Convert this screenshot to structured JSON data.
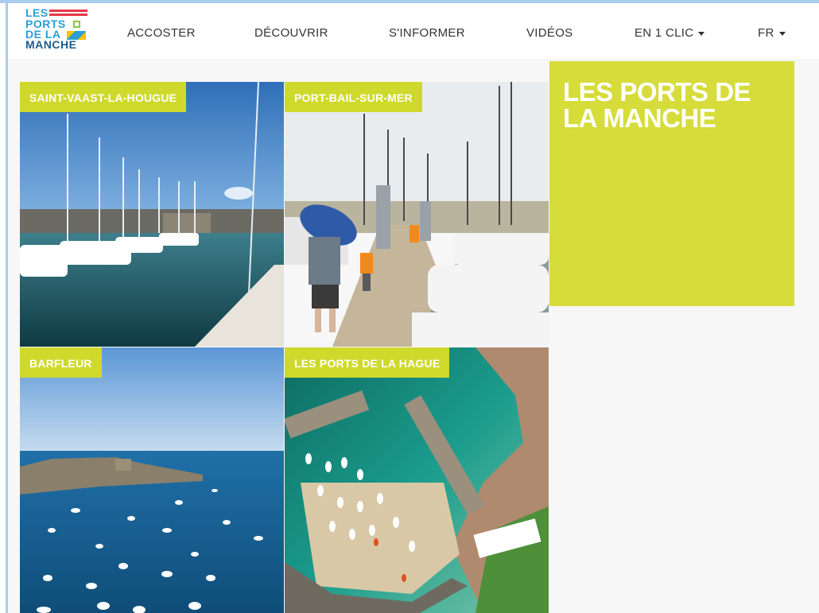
{
  "header": {
    "logo_lines": [
      "LES",
      "PORTS",
      "DE LA",
      "MANCHE"
    ],
    "nav": [
      {
        "label": "ACCOSTER",
        "dropdown": false
      },
      {
        "label": "DÉCOUVRIR",
        "dropdown": false
      },
      {
        "label": "S'INFORMER",
        "dropdown": false
      },
      {
        "label": "VIDÉOS",
        "dropdown": false
      },
      {
        "label": "EN 1 CLIC",
        "dropdown": true
      },
      {
        "label": "FR",
        "dropdown": true
      }
    ]
  },
  "tiles": [
    {
      "label": "SAINT-VAAST-LA-HOUGUE"
    },
    {
      "label": "PORT-BAIL-SUR-MER"
    },
    {
      "label": "BARFLEUR"
    },
    {
      "label": "LES PORTS DE LA HAGUE"
    }
  ],
  "hero": {
    "title": "LES PORTS DE LA MANCHE"
  },
  "colors": {
    "accent": "#cfd92c",
    "hero_bg": "#d6dc3a",
    "logo_blue": "#2a9fd6",
    "logo_dark_blue": "#1d5b8f",
    "frame": "#a9cdee"
  }
}
